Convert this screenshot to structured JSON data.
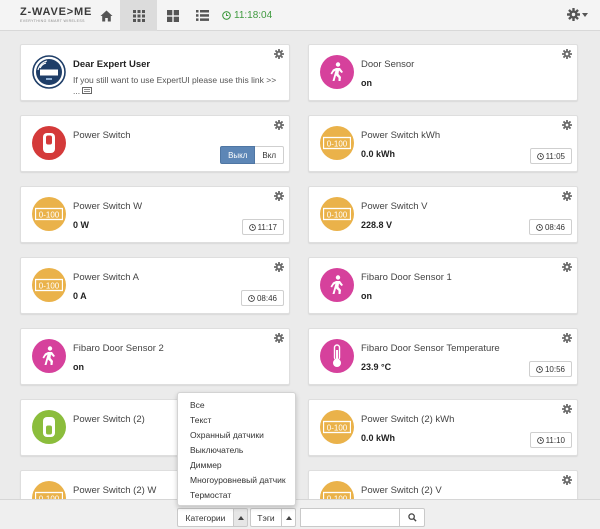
{
  "brand": {
    "name": "Z-WAVE>ME",
    "tagline": "EVERYTHING SMART WIRELESS"
  },
  "header": {
    "time": "11:18:04"
  },
  "widgets": [
    {
      "title": "Dear Expert User",
      "note": "If you still want to use ExpertUI please use this link >> ...",
      "icon": "zwave-plus-logo"
    },
    {
      "title": "Door Sensor",
      "value": "on",
      "icon": "door-sensor-icon"
    },
    {
      "title": "Power Switch",
      "switch": {
        "off": "Выкл",
        "on": "Вкл"
      },
      "icon": "power-switch-icon"
    },
    {
      "title": "Power Switch kWh",
      "value": "0.0 kWh",
      "time": "11:05",
      "icon": "meter-icon"
    },
    {
      "title": "Power Switch W",
      "value": "0 W",
      "time": "11:17",
      "icon": "meter-icon"
    },
    {
      "title": "Power Switch V",
      "value": "228.8 V",
      "time": "08:46",
      "icon": "meter-icon"
    },
    {
      "title": "Power Switch A",
      "value": "0 A",
      "time": "08:46",
      "icon": "meter-icon"
    },
    {
      "title": "Fibaro Door Sensor 1",
      "value": "on",
      "icon": "door-sensor-icon"
    },
    {
      "title": "Fibaro Door Sensor 2",
      "value": "on",
      "icon": "door-sensor-icon"
    },
    {
      "title": "Fibaro Door Sensor Temperature",
      "value": "23.9 °C",
      "time": "10:56",
      "icon": "thermometer-icon"
    },
    {
      "title": "Power Switch (2)",
      "icon": "power-switch-icon"
    },
    {
      "title": "Power Switch (2) kWh",
      "value": "0.0 kWh",
      "time": "11:10",
      "icon": "meter-icon"
    },
    {
      "title": "Power Switch (2) W",
      "icon": "meter-icon"
    },
    {
      "title": "Power Switch (2) V",
      "icon": "meter-icon"
    }
  ],
  "meter_label": "0-100",
  "dropdown": {
    "items": [
      "Все",
      "Текст",
      "Охранный датчики",
      "Выключатель",
      "Диммер",
      "Многоуровневый датчик",
      "Термостат"
    ]
  },
  "footer": {
    "categories_label": "Категории",
    "tags_label": "Тэги"
  },
  "colors": {
    "meter": "#eab24a",
    "sensor": "#d6419c",
    "switch_red": "#d43a3a",
    "switch_green": "#8bbd3c",
    "clock": "#3f9a3f",
    "accent": "#5d86b6"
  }
}
